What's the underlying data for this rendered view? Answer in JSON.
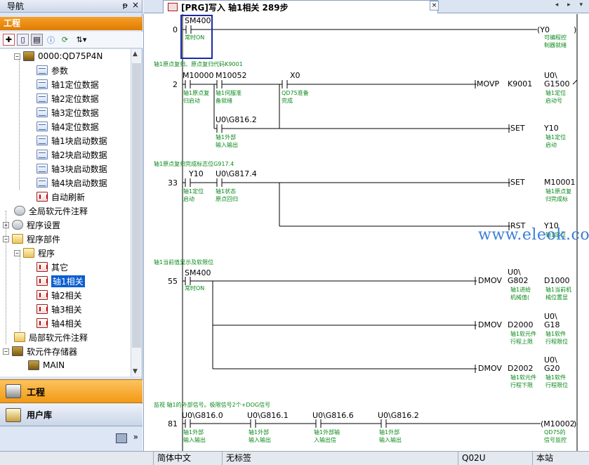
{
  "nav": {
    "title": "导航",
    "pin_glyph": "ᵽ",
    "close_glyph": "×",
    "section": "工程",
    "tree": [
      {
        "label": "0000:QD75P4N",
        "indent": 1,
        "icon": "chip",
        "exp": "−"
      },
      {
        "label": "参数",
        "indent": 3,
        "icon": "grid"
      },
      {
        "label": "轴1定位数据",
        "indent": 3,
        "icon": "grid"
      },
      {
        "label": "轴2定位数据",
        "indent": 3,
        "icon": "grid"
      },
      {
        "label": "轴3定位数据",
        "indent": 3,
        "icon": "grid"
      },
      {
        "label": "轴4定位数据",
        "indent": 3,
        "icon": "grid"
      },
      {
        "label": "轴1块启动数据",
        "indent": 3,
        "icon": "grid"
      },
      {
        "label": "轴2块启动数据",
        "indent": 3,
        "icon": "grid"
      },
      {
        "label": "轴3块启动数据",
        "indent": 3,
        "icon": "grid"
      },
      {
        "label": "轴4块启动数据",
        "indent": 3,
        "icon": "grid"
      },
      {
        "label": "自动刷新",
        "indent": 3,
        "icon": "prg"
      },
      {
        "label": "全局软元件注释",
        "indent": 1,
        "icon": "gear"
      },
      {
        "label": "程序设置",
        "indent": 0,
        "icon": "gear",
        "exp": "+"
      },
      {
        "label": "程序部件",
        "indent": 0,
        "icon": "folder",
        "exp": "−"
      },
      {
        "label": "程序",
        "indent": 1,
        "icon": "folder",
        "exp": "−"
      },
      {
        "label": "其它",
        "indent": 3,
        "icon": "prg"
      },
      {
        "label": "轴1相关",
        "indent": 3,
        "icon": "prg",
        "selected": true
      },
      {
        "label": "轴2相关",
        "indent": 3,
        "icon": "prg"
      },
      {
        "label": "轴3相关",
        "indent": 3,
        "icon": "prg"
      },
      {
        "label": "轴4相关",
        "indent": 3,
        "icon": "prg"
      },
      {
        "label": "局部软元件注释",
        "indent": 1,
        "icon": "folder"
      },
      {
        "label": "软元件存储器",
        "indent": 0,
        "icon": "chip",
        "exp": "−"
      },
      {
        "label": "MAIN",
        "indent": 2,
        "icon": "chip"
      }
    ],
    "btn_project": "工程",
    "btn_library": "用户库",
    "more_glyph": "»"
  },
  "tab": {
    "label": "[PRG]写入 轴1相关 289步",
    "close_glyph": "×",
    "arrows": "◂ ▸ ▾"
  },
  "rungs": {
    "r0": {
      "step": "0",
      "contact": "SM400",
      "contact_cmt": "常时ON",
      "coil": "(Y0",
      "coil_close": ")",
      "coil_cmt1": "可编程控",
      "coil_cmt2": "制器就绪"
    },
    "r2": {
      "header": "轴1原点复归、原点复归代码K9001",
      "step": "2",
      "c1": "M10000",
      "c1_cmt1": "轴1原点复",
      "c1_cmt2": "归启动",
      "c2": "M10052",
      "c2_cmt1": "轴1伺服准",
      "c2_cmt2": "备就绪",
      "c3": "X0",
      "c3_cmt1": "QD75准备",
      "c3_cmt2": "完成",
      "c4": "U0\\G816.2",
      "c4_cmt1": "轴1外部",
      "c4_cmt2": "输入输出",
      "instr1": "MOVP",
      "op1a": "K9001",
      "op1b1": "U0\\",
      "op1b2": "G1500",
      "op1b_cmt1": "轴1定位",
      "op1b_cmt2": "启动号",
      "instr2": "SET",
      "op2": "Y10",
      "op2_cmt1": "轴1定位",
      "op2_cmt2": "启动"
    },
    "r33": {
      "header": "轴1原点复归完成标志位G917.4",
      "step": "33",
      "c1": "Y10",
      "c1_cmt1": "轴1定位",
      "c1_cmt2": "启动",
      "c2": "U0\\G817.4",
      "c2_cmt1": "轴1状态",
      "c2_cmt2": "原点回归",
      "instr1": "SET",
      "op1": "M10001",
      "op1_cmt1": "轴1原点复",
      "op1_cmt2": "归完成标",
      "instr2": "RST",
      "op2": "Y10",
      "op2_cmt1": "轴1定位"
    },
    "r55": {
      "header": "轴1当前值显示及软限位",
      "step": "55",
      "contact": "SM400",
      "contact_cmt": "常时ON",
      "i1": "DMOV",
      "i1a1": "U0\\",
      "i1a2": "G802",
      "i1a_cmt1": "轴1进给",
      "i1a_cmt2": "机械值(",
      "i1b": "D1000",
      "i1b_cmt1": "轴1当前机",
      "i1b_cmt2": "械位置显",
      "i2": "DMOV",
      "i2a": "D2000",
      "i2a_cmt1": "轴1软元件",
      "i2a_cmt2": "行程上限",
      "i2b1": "U0\\",
      "i2b2": "G18",
      "i2b_cmt1": "轴1软件",
      "i2b_cmt2": "行程限位",
      "i3": "DMOV",
      "i3a": "D2002",
      "i3a_cmt1": "轴1软元件",
      "i3a_cmt2": "行程下限",
      "i3b1": "U0\\",
      "i3b2": "G20",
      "i3b_cmt1": "轴1软件",
      "i3b_cmt2": "行程限位"
    },
    "r81": {
      "header": "监视 轴1的外部信号。极限信号2个+DOG信号",
      "step": "81",
      "c1": "U0\\G816.0",
      "c1_cmt1": "轴1外部",
      "c1_cmt2": "输入输出",
      "c2": "U0\\G816.1",
      "c2_cmt1": "轴1外部",
      "c2_cmt2": "输入输出",
      "c3": "U0\\G816.6",
      "c3_cmt1": "轴1外部输",
      "c3_cmt2": "入输出信",
      "c4": "U0\\G816.2",
      "c4_cmt1": "轴1外部",
      "c4_cmt2": "输入输出",
      "coil": "(M10002",
      "coil_close": ")",
      "coil_cmt1": "QD75的",
      "coil_cmt2": "信号监控"
    }
  },
  "watermark": "www.eleok.com",
  "status": {
    "language": "简体中文",
    "label": "无标签",
    "cpu": "Q02U",
    "station": "本站"
  }
}
